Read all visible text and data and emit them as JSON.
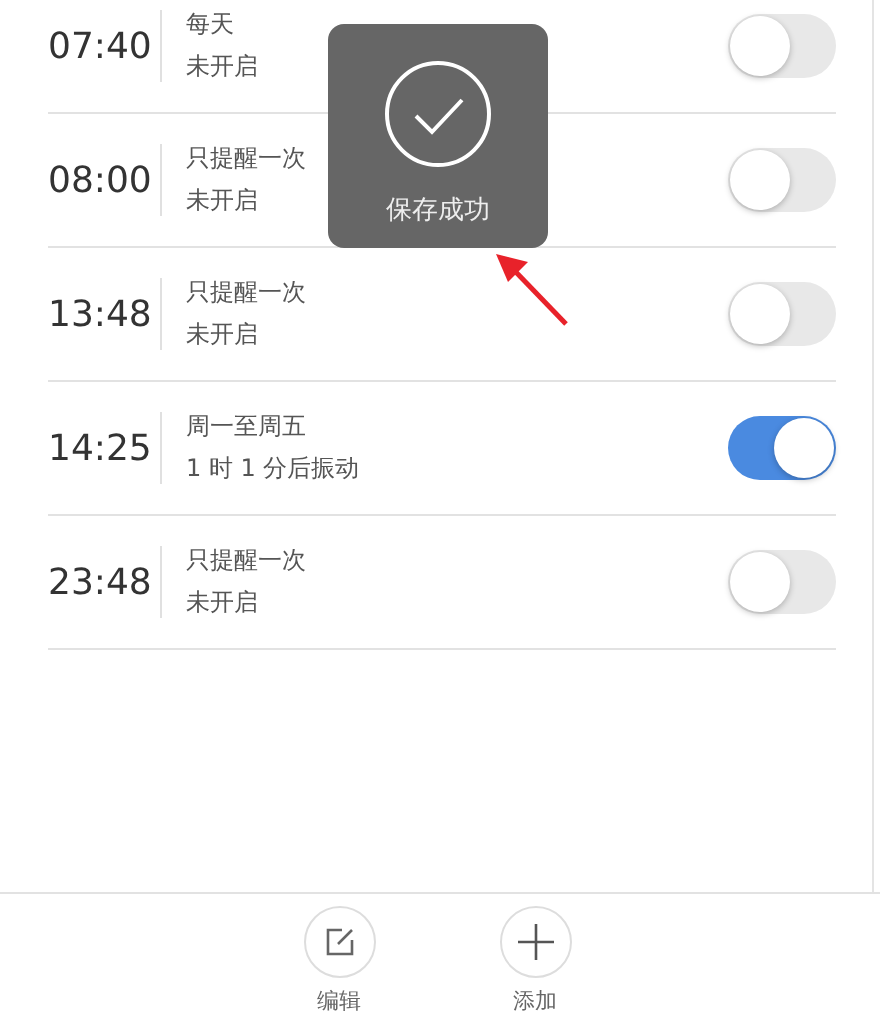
{
  "alarms": [
    {
      "time": "07:40",
      "repeat": "每天",
      "status": "未开启",
      "on": false
    },
    {
      "time": "08:00",
      "repeat": "只提醒一次",
      "status": "未开启",
      "on": false
    },
    {
      "time": "13:48",
      "repeat": "只提醒一次",
      "status": "未开启",
      "on": false
    },
    {
      "time": "14:25",
      "repeat": "周一至周五",
      "status": "1 时 1 分后振动",
      "on": true
    },
    {
      "time": "23:48",
      "repeat": "只提醒一次",
      "status": "未开启",
      "on": false
    }
  ],
  "toast": {
    "message": "保存成功"
  },
  "toolbar": [
    {
      "kind": "edit",
      "label": "编辑"
    },
    {
      "kind": "add",
      "label": "添加"
    }
  ]
}
